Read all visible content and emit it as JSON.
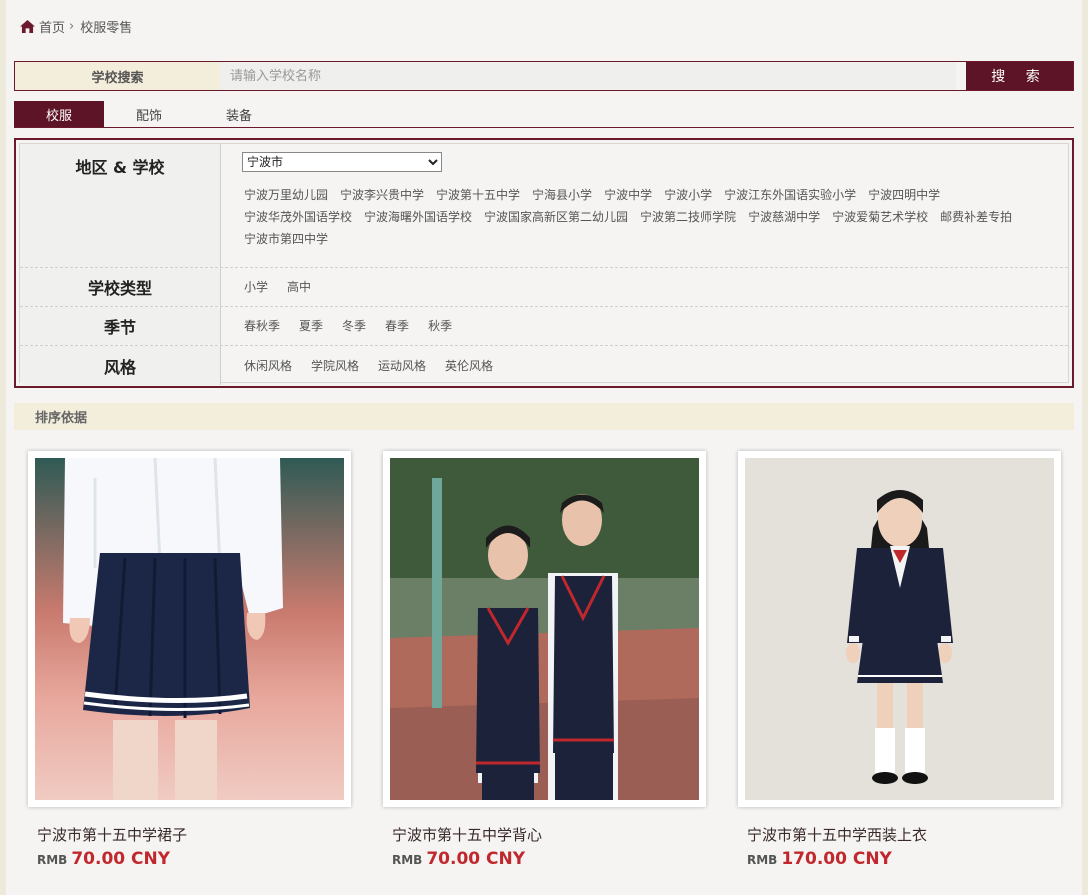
{
  "breadcrumb": {
    "home": "首页",
    "separator": "›",
    "current": "校服零售"
  },
  "search": {
    "label": "学校搜索",
    "placeholder": "请输入学校名称",
    "button": "搜 索"
  },
  "tabs": [
    {
      "label": "校服",
      "active": true
    },
    {
      "label": "配饰",
      "active": false
    },
    {
      "label": "装备",
      "active": false
    }
  ],
  "filters": {
    "region": {
      "label": "地区 & 学校",
      "selected": "宁波市",
      "schools": [
        "宁波万里幼儿园",
        "宁波李兴贵中学",
        "宁波第十五中学",
        "宁海县小学",
        "宁波中学",
        "宁波小学",
        "宁波江东外国语实验小学",
        "宁波四明中学",
        "宁波华茂外国语学校",
        "宁波海曙外国语学校",
        "宁波国家高新区第二幼儿园",
        "宁波第二技师学院",
        "宁波慈湖中学",
        "宁波爱菊艺术学校",
        "邮费补差专拍",
        "宁波市第四中学"
      ]
    },
    "school_type": {
      "label": "学校类型",
      "options": [
        "小学",
        "高中"
      ]
    },
    "season": {
      "label": "季节",
      "options": [
        "春秋季",
        "夏季",
        "冬季",
        "春季",
        "秋季"
      ]
    },
    "style": {
      "label": "风格",
      "options": [
        "休闲风格",
        "学院风格",
        "运动风格",
        "英伦风格"
      ]
    }
  },
  "sort_label": "排序依据",
  "products": [
    {
      "name": "宁波市第十五中学裙子",
      "currency_prefix": "RMB",
      "price": "70.00 CNY"
    },
    {
      "name": "宁波市第十五中学背心",
      "currency_prefix": "RMB",
      "price": "70.00 CNY"
    },
    {
      "name": "宁波市第十五中学西装上衣",
      "currency_prefix": "RMB",
      "price": "170.00 CNY"
    }
  ],
  "colors": {
    "brand": "#5e1427",
    "price": "#c0282d",
    "label_bg": "#f3eedb"
  },
  "icons": {
    "home": "home-icon",
    "dropdown": "chevron-down-icon"
  }
}
